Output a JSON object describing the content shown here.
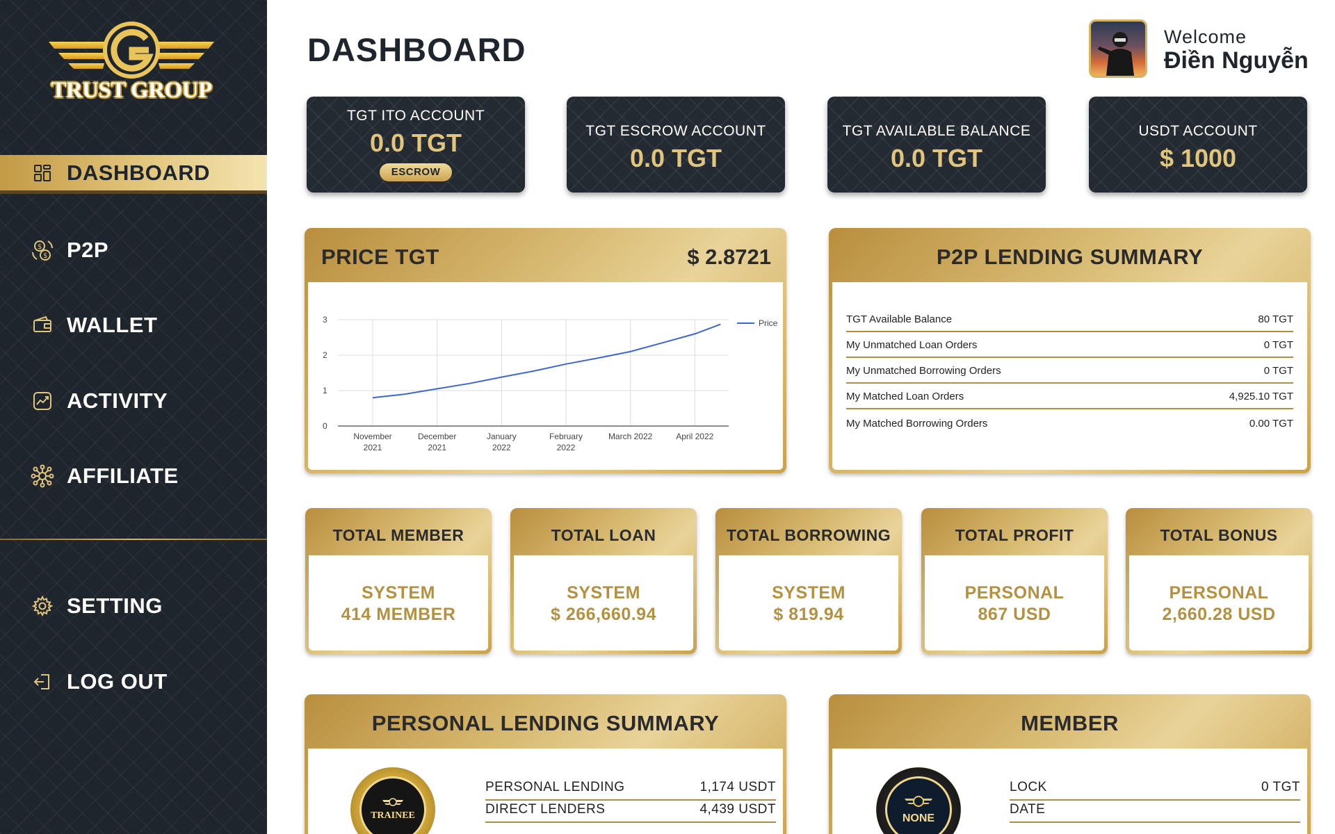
{
  "sidebar": {
    "logo_text": "TRUST GROUP",
    "items": [
      {
        "label": "DASHBOARD",
        "icon": "dashboard-grid-icon",
        "active": true
      },
      {
        "label": "P2P",
        "icon": "p2p-exchange-icon"
      },
      {
        "label": "WALLET",
        "icon": "wallet-icon"
      },
      {
        "label": "ACTIVITY",
        "icon": "activity-chart-icon"
      },
      {
        "label": "AFFILIATE",
        "icon": "affiliate-network-icon"
      }
    ],
    "bottom_items": [
      {
        "label": "SETTING",
        "icon": "gear-icon"
      },
      {
        "label": "LOG OUT",
        "icon": "logout-icon"
      }
    ]
  },
  "header": {
    "title": "DASHBOARD",
    "welcome": "Welcome",
    "username": "Điền Nguyễn"
  },
  "accounts": [
    {
      "label": "TGT ITO ACCOUNT",
      "value": "0.0 TGT",
      "button": "ESCROW"
    },
    {
      "label": "TGT ESCROW ACCOUNT",
      "value": "0.0 TGT"
    },
    {
      "label": "TGT AVAILABLE BALANCE",
      "value": "0.0 TGT"
    },
    {
      "label": "USDT ACCOUNT",
      "value": "$ 1000"
    }
  ],
  "price_panel": {
    "title": "PRICE TGT",
    "value": "$ 2.8721"
  },
  "chart_data": {
    "type": "line",
    "x": [
      "November 2021",
      "December 2021",
      "January 2022",
      "February 2022",
      "March 2022",
      "April 2022"
    ],
    "x_tick_lines": [
      [
        "November",
        "2021"
      ],
      [
        "December",
        "2021"
      ],
      [
        "January",
        "2022"
      ],
      [
        "February",
        "2022"
      ],
      [
        "March 2022"
      ],
      [
        "April 2022"
      ]
    ],
    "series": [
      {
        "name": "Price",
        "color": "#3b66d6",
        "points": [
          [
            0.0,
            0.8
          ],
          [
            0.5,
            0.9
          ],
          [
            1.0,
            1.05
          ],
          [
            1.5,
            1.2
          ],
          [
            2.0,
            1.38
          ],
          [
            2.5,
            1.55
          ],
          [
            3.0,
            1.75
          ],
          [
            3.5,
            1.92
          ],
          [
            4.0,
            2.1
          ],
          [
            4.5,
            2.35
          ],
          [
            5.0,
            2.6
          ],
          [
            5.4,
            2.87
          ]
        ]
      }
    ],
    "yticks": [
      0,
      1,
      2,
      3
    ],
    "ylim": [
      0,
      3
    ],
    "grid": true,
    "legend": "top-right"
  },
  "p2p_summary": {
    "title": "P2P LENDING SUMMARY",
    "rows": [
      {
        "label": "TGT Available Balance",
        "value": "80 TGT"
      },
      {
        "label": "My Unmatched Loan Orders",
        "value": "0 TGT"
      },
      {
        "label": "My Unmatched Borrowing Orders",
        "value": "0 TGT"
      },
      {
        "label": "My Matched Loan Orders",
        "value": "4,925.10 TGT"
      },
      {
        "label": "My Matched Borrowing Orders",
        "value": "0.00 TGT"
      }
    ]
  },
  "stats": [
    {
      "title": "TOTAL MEMBER",
      "line1": "SYSTEM",
      "line2": "414 MEMBER"
    },
    {
      "title": "TOTAL LOAN",
      "line1": "SYSTEM",
      "line2": "$ 266,660.94"
    },
    {
      "title": "TOTAL BORROWING",
      "line1": "SYSTEM",
      "line2": "$ 819.94"
    },
    {
      "title": "TOTAL PROFIT",
      "line1": "PERSONAL",
      "line2": "867 USD"
    },
    {
      "title": "TOTAL BONUS",
      "line1": "PERSONAL",
      "line2": "2,660.28 USD"
    }
  ],
  "personal_lending": {
    "title": "PERSONAL LENDING SUMMARY",
    "badge": "TRAINEE",
    "rows": [
      {
        "label": "PERSONAL LENDING",
        "value": "1,174 USDT"
      },
      {
        "label": "DIRECT LENDERS",
        "value": "4,439 USDT"
      }
    ]
  },
  "member": {
    "title": "MEMBER",
    "badge": "NONE",
    "rows": [
      {
        "label": "LOCK",
        "value": "0 TGT"
      },
      {
        "label": "DATE",
        "value": ""
      }
    ]
  },
  "colors": {
    "sidebar_bg": "#1f252c",
    "gold": "#d4b265",
    "gold_text": "#b5913f",
    "line": "#3b66d6"
  }
}
